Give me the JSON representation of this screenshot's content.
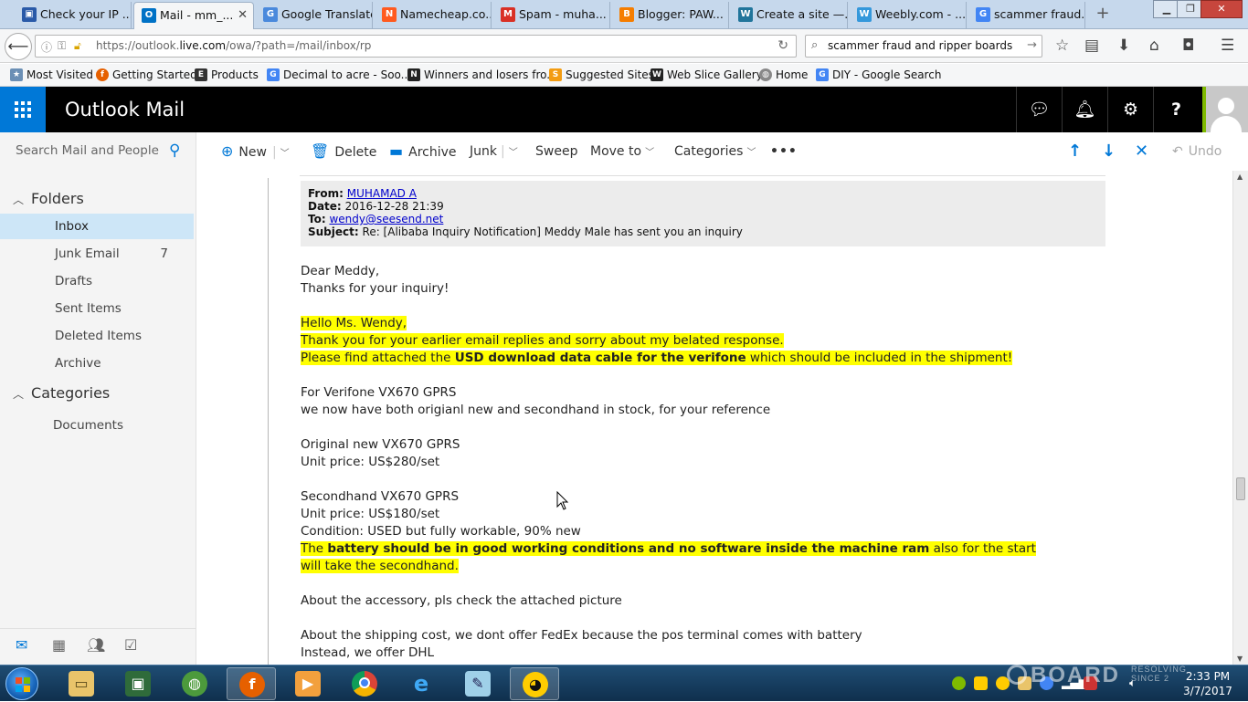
{
  "browser": {
    "tabs": [
      {
        "title": "Check your IP ...",
        "fav": "IP",
        "color": "#2a5aa8"
      },
      {
        "title": "Mail - mm_...",
        "fav": "O",
        "color": "#0072c6",
        "active": true
      },
      {
        "title": "Google Translate",
        "fav": "G",
        "color": "#4a89dc"
      },
      {
        "title": "Namecheap.co...",
        "fav": "N",
        "color": "#ff5a1f"
      },
      {
        "title": "Spam - muha...",
        "fav": "M",
        "color": "#d93025"
      },
      {
        "title": "Blogger: PAW...",
        "fav": "B",
        "color": "#f57d00"
      },
      {
        "title": "Create a site —...",
        "fav": "W",
        "color": "#21759b"
      },
      {
        "title": "Weebly.com - ...",
        "fav": "W",
        "color": "#3498db"
      },
      {
        "title": "scammer fraud...",
        "fav": "G",
        "color": "#4285f4"
      }
    ],
    "url_prefix": "https://outlook.",
    "url_domain": "live.com",
    "url_path": "/owa/?path=/mail/inbox/rp",
    "search_value": "scammer fraud and ripper boards",
    "bookmarks": [
      {
        "label": "Most Visited",
        "icon": "star-icon",
        "color": "#6b8fb5"
      },
      {
        "label": "Getting Started",
        "icon": "firefox-icon",
        "color": "#e66000"
      },
      {
        "label": "Products",
        "icon": "E",
        "color": "#333"
      },
      {
        "label": "Decimal to acre - Soo...",
        "icon": "G",
        "color": "#4285f4"
      },
      {
        "label": "Winners and losers fro...",
        "icon": "N",
        "color": "#222"
      },
      {
        "label": "Suggested Sites",
        "icon": "S",
        "color": "#f39c12"
      },
      {
        "label": "Web Slice Gallery",
        "icon": "W",
        "color": "#222"
      },
      {
        "label": "Home",
        "icon": "globe-icon",
        "color": "#888"
      },
      {
        "label": "DIY - Google Search",
        "icon": "G",
        "color": "#4285f4"
      }
    ]
  },
  "owa": {
    "app_title": "Outlook Mail",
    "search_placeholder": "Search Mail and People",
    "commands": {
      "new": "New",
      "delete": "Delete",
      "archive": "Archive",
      "junk": "Junk",
      "sweep": "Sweep",
      "move_to": "Move to",
      "categories": "Categories",
      "more": "•••",
      "undo": "Undo"
    },
    "nav": {
      "folders_heading": "Folders",
      "folders": [
        {
          "label": "Inbox",
          "count": "",
          "selected": true
        },
        {
          "label": "Junk Email",
          "count": "7"
        },
        {
          "label": "Drafts",
          "count": ""
        },
        {
          "label": "Sent Items",
          "count": ""
        },
        {
          "label": "Deleted Items",
          "count": ""
        },
        {
          "label": "Archive",
          "count": ""
        }
      ],
      "categories_heading": "Categories",
      "categories": [
        {
          "label": "Documents"
        }
      ]
    }
  },
  "message": {
    "from_label": "From:",
    "from_value": "MUHAMAD A",
    "date_label": "Date:",
    "date_value": "2016-12-28 21:39",
    "to_label": "To:",
    "to_value": "wendy@seesend.net",
    "subject_label": "Subject:",
    "subject_value": "Re: [Alibaba Inquiry Notification] Meddy Male has sent you an inquiry",
    "lines": {
      "greeting": "Dear Meddy,",
      "thanks": "Thanks for your inquiry!",
      "hello": "Hello Ms. Wendy,",
      "apology": "Thank you for your earlier email replies and sorry about my belated response.",
      "attach_a": "Please find attached the ",
      "attach_b": "USD download data cable for the verifone",
      "attach_c": " which should be included in the shipment!",
      "verifone": "For Verifone VX670 GPRS",
      "stock": "we now have both origianl new and secondhand in stock, for your reference",
      "orig_title": "Original new VX670 GPRS",
      "orig_price": "Unit price: US$280/set",
      "sec_title": "Secondhand VX670 GPRS",
      "sec_price": "Unit price: US$180/set",
      "condition": "Condition: USED but fully workable, 90% new",
      "battery_a": "The ",
      "battery_b": "battery should be in good working conditions and no software inside the machine ram",
      "battery_c": " also for the start will take the secondhand.",
      "accessory": "About the accessory, pls check the attached picture",
      "shipping": "About the shipping cost, we dont offer FedEx because the pos terminal comes with battery",
      "dhl": "Instead, we offer DHL"
    }
  },
  "taskbar": {
    "time": "2:33 PM",
    "date": "3/7/2017",
    "watermark_big": "BOARD",
    "watermark_small": "RESOLVING SINCE 2"
  },
  "colors": {
    "accent": "#0078d7",
    "highlight": "#ffff00",
    "selected_folder": "#cde6f7"
  }
}
